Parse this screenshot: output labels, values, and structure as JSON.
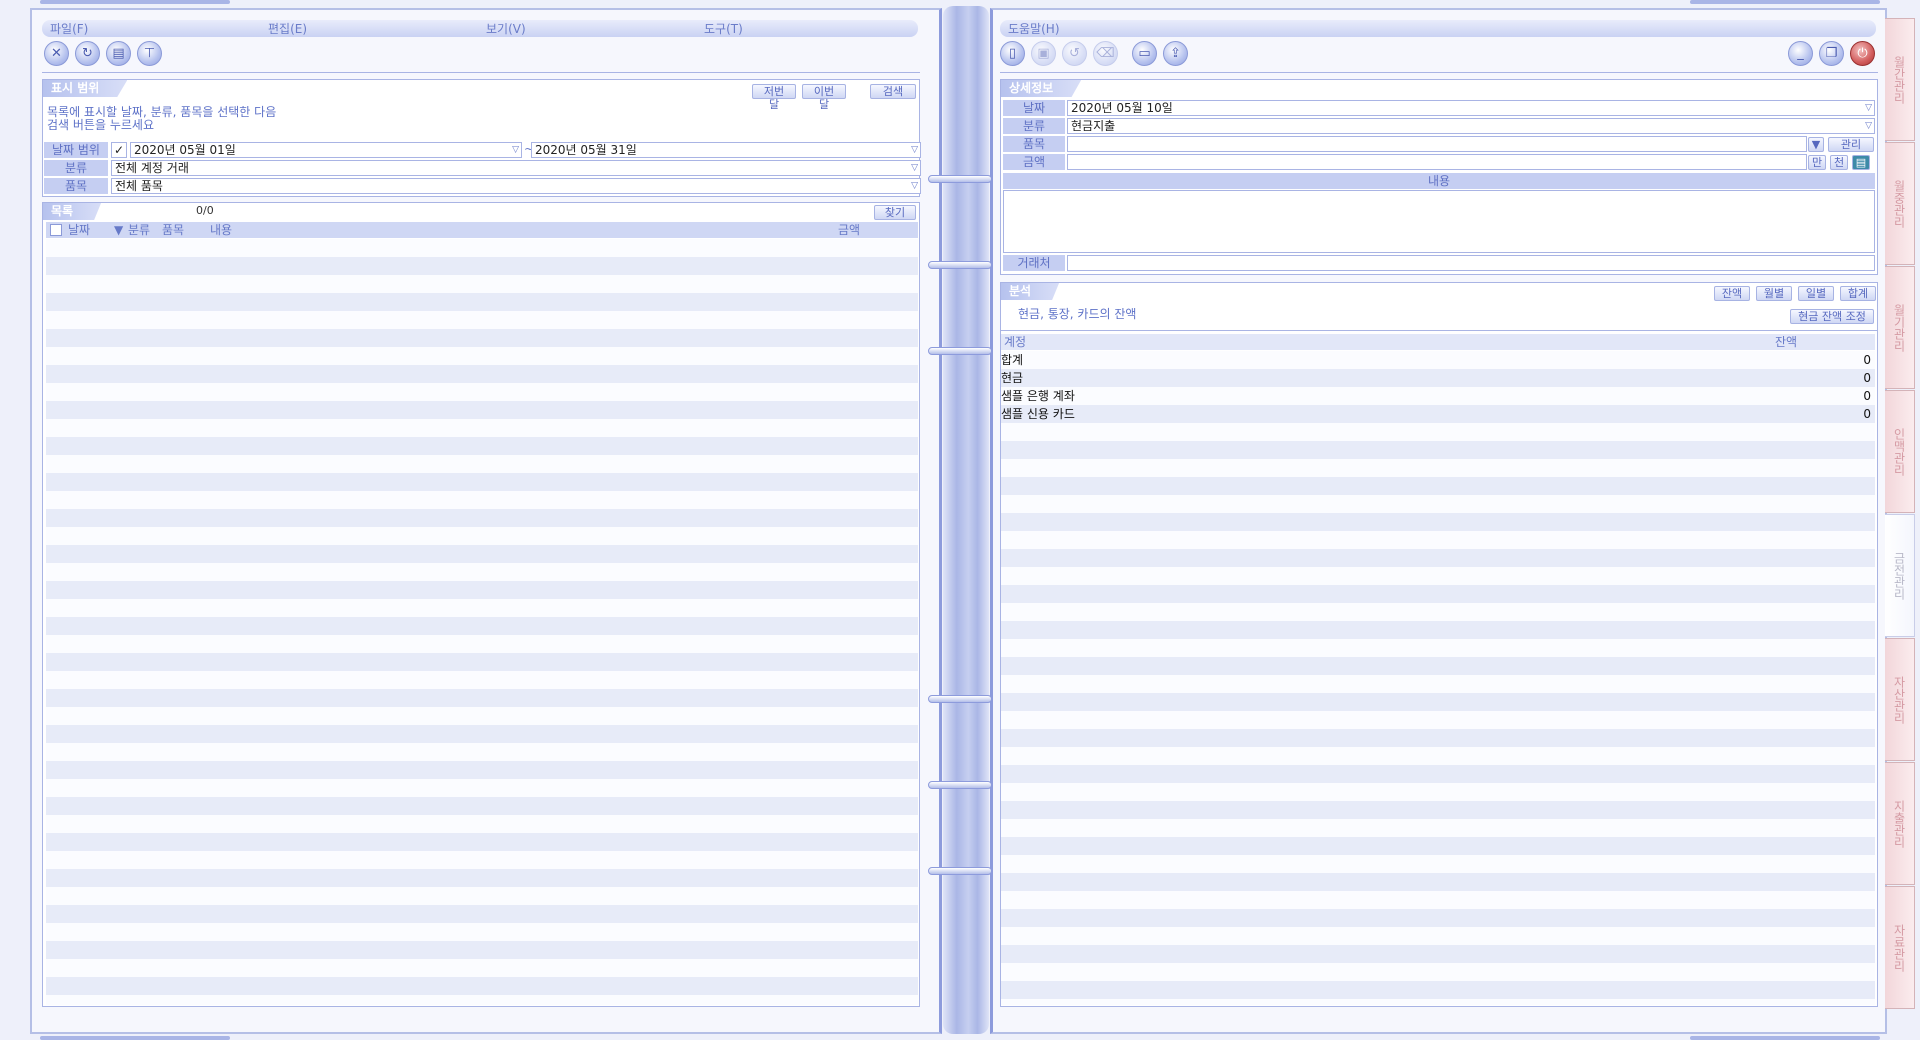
{
  "menu": {
    "file": "파일(F)",
    "edit": "편집(E)",
    "view": "보기(V)",
    "tools": "도구(T)",
    "help": "도움말(H)"
  },
  "toolbar_icons": [
    "delete-icon",
    "refresh-icon",
    "print-icon",
    "filter-icon"
  ],
  "right_toolbar_icons": [
    "new-icon",
    "save-icon",
    "undo-icon",
    "trash-icon",
    "card-icon",
    "export-icon"
  ],
  "window_controls": [
    "minimize-icon",
    "restore-icon",
    "power-icon"
  ],
  "range": {
    "title": "표시 범위",
    "prev_month": "저번달",
    "this_month": "이번달",
    "search": "검색",
    "hint_line1": "목록에 표시할 날짜, 분류, 품목을 선택한 다음",
    "hint_line2": "검색 버튼을 누르세요",
    "date_label": "날짜 범위",
    "date_from": "2020년 05월 01일",
    "tilde": "~",
    "date_to": "2020년 05월 31일",
    "category_label": "분류",
    "category_value": "전체 계정 거래",
    "item_label": "품목",
    "item_value": "전체 품목"
  },
  "list": {
    "title": "목록",
    "count": "0/0",
    "find": "찾기",
    "columns": {
      "date": "날짜",
      "sort": "▼",
      "category": "분류",
      "item": "품목",
      "content": "내용",
      "amount": "금액"
    }
  },
  "detail": {
    "title": "상세정보",
    "date_label": "날짜",
    "date_value": "2020년 05월 10일",
    "category_label": "분류",
    "category_value": "현금지출",
    "item_label": "품목",
    "item_value": "",
    "manage": "관리",
    "amount_label": "금액",
    "amount_value": "",
    "man": "만",
    "cheon": "천",
    "content_label": "내용",
    "vendor_label": "거래처",
    "vendor_value": ""
  },
  "analysis": {
    "title": "분석",
    "tabs": [
      "잔액",
      "월별",
      "일별",
      "합계"
    ],
    "subtitle": "현금, 통장, 카드의 잔액",
    "adjust": "현금 잔액 조정",
    "col_account": "계정",
    "col_balance": "잔액",
    "rows": [
      {
        "name": "합계",
        "value": "0"
      },
      {
        "name": "현금",
        "value": "0"
      },
      {
        "name": "샘플 은행 계좌",
        "value": "0"
      },
      {
        "name": "샘플 신용 카드",
        "value": "0"
      }
    ]
  },
  "side_tabs": [
    "월간관리",
    "월중관리",
    "월기관리",
    "인맥관리",
    "금전관리",
    "자산관리",
    "지출관리",
    "자료관리"
  ],
  "colors": {
    "accent": "#6a7cc9",
    "panel": "#c5cef2",
    "page": "#f6f7fd",
    "power": "#d25d5d"
  }
}
